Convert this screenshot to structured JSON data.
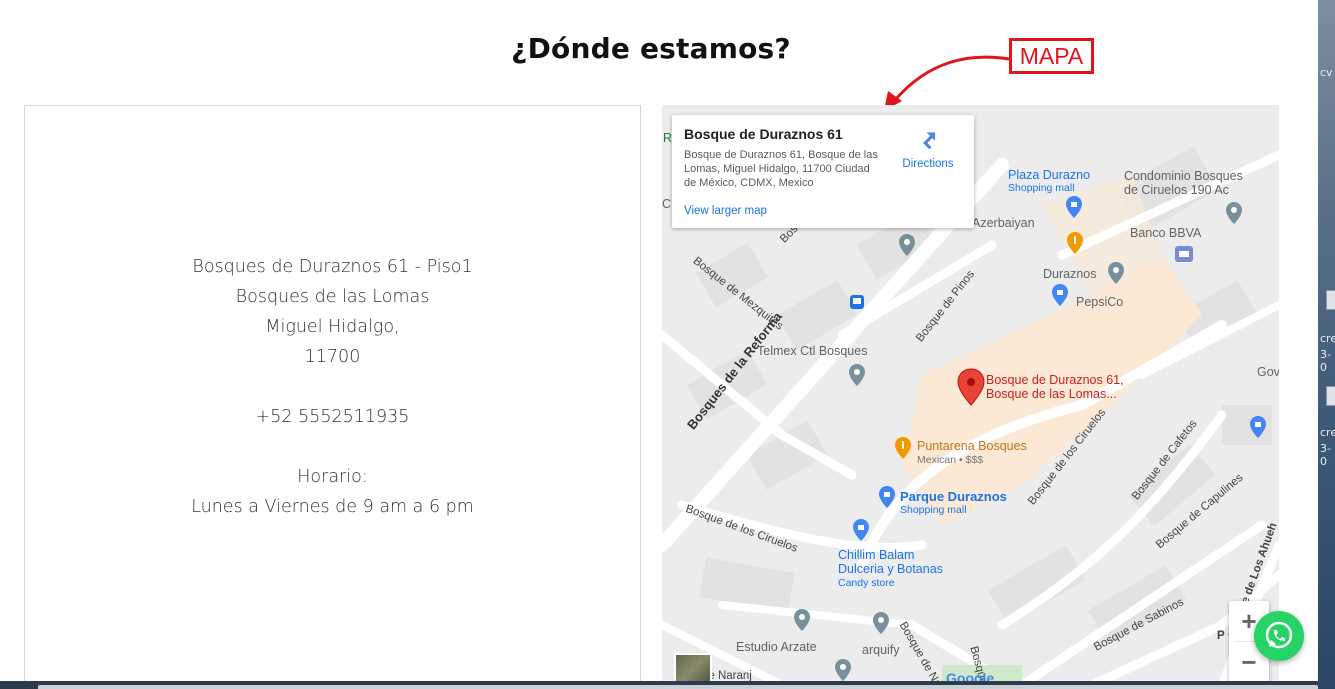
{
  "section": {
    "title": "¿Dónde estamos?"
  },
  "annotation": {
    "label": "MAPA"
  },
  "contact": {
    "address_line1": "Bosques de Duraznos 61 - Piso1",
    "address_line2": "Bosques de las Lomas",
    "address_line3": "Miguel Hidalgo,",
    "address_line4": "11700",
    "phone": "+52 5552511935",
    "hours_label": "Horario:",
    "hours_value": "Lunes a Viernes de 9 am a 6 pm"
  },
  "map": {
    "place_card": {
      "title": "Bosque de Duraznos 61",
      "address": "Bosque de Duraznos 61, Bosque de las Lomas, Miguel Hidalgo, 11700 Ciudad de México, CDMX, Mexico",
      "directions_label": "Directions",
      "larger_map_label": "View larger map"
    },
    "marker": {
      "line1": "Bosque de Duraznos 61,",
      "line2": "Bosque de las Lomas..."
    },
    "places": {
      "plaza_durazno": "Plaza Durazno",
      "plaza_durazno_sub": "Shopping mall",
      "condominio": "Condominio Bosques",
      "condominio_line2": "de Ciruelos 190 Ac",
      "azerbaiyan": "Azerbaiyan",
      "banco_bbva": "Banco BBVA",
      "duraznos": "Duraznos",
      "pepsico": "PepsiCo",
      "telmex": "Telmex Ctl Bosques",
      "puntarena": "Puntarena Bosques",
      "puntarena_sub": "Mexican • $$$",
      "parque_duraznos": "Parque Duraznos",
      "parque_duraznos_sub": "Shopping mall",
      "chillim_line1": "Chillim Balam",
      "chillim_line2": "Dulceria y Botanas",
      "chillim_sub": "Candy store",
      "estudio_arzate": "Estudio Arzate",
      "arquify": "arquify",
      "gove": "Gove",
      "google": "Google",
      "r_edge": "R",
      "c_edge": "C"
    },
    "streets": {
      "reforma": "Bosques de la Reforma",
      "mezquites": "Bosque de Mezquites",
      "pinos": "Bosque de Pinos",
      "ciruelos_a": "Bosque de los Ciruelos",
      "ciruelos_b": "Bosque de los Ciruelos",
      "cafetos": "Bosque de Cafetos",
      "capulines": "Bosque de Capulines",
      "sabinos": "Bosque de Sabinos",
      "ahuehuetes": "Bosque de Los Ahueh",
      "naranjos": "Bosque de Naranjos",
      "naranjos_b": "de Naranj",
      "bosq_short": "Bosq",
      "bosque_short2": "Bosque",
      "pe": "P"
    },
    "zoom_in": "+",
    "zoom_out": "−"
  },
  "desktop": {
    "cv": "cv",
    "cre1": "cre",
    "num1": "3-0",
    "cre2": "cre",
    "num2": "3-0"
  },
  "colors": {
    "annotation_red": "#e0141a",
    "link_blue": "#1a73e8",
    "whatsapp_green": "#25d366",
    "marker_red": "#ea4335"
  }
}
